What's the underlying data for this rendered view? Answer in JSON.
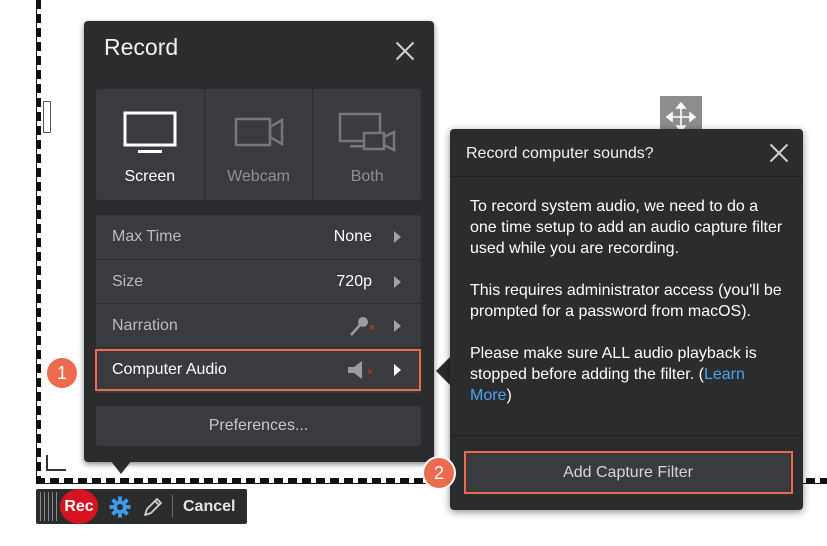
{
  "record_panel": {
    "title": "Record",
    "modes": [
      {
        "label": "Screen",
        "icon": "monitor-icon",
        "selected": true
      },
      {
        "label": "Webcam",
        "icon": "webcam-icon",
        "selected": false
      },
      {
        "label": "Both",
        "icon": "screen-webcam-icon",
        "selected": false
      }
    ],
    "rows": [
      {
        "label": "Max Time",
        "value": "None"
      },
      {
        "label": "Size",
        "value": "720p"
      },
      {
        "label": "Narration",
        "value_icon": "microphone-muted-icon"
      },
      {
        "label": "Computer Audio",
        "value_icon": "speaker-muted-icon"
      }
    ],
    "preferences_label": "Preferences..."
  },
  "popup": {
    "title": "Record computer sounds?",
    "paragraph1": "To record system audio, we need to do a one time setup to add an audio capture filter used while you are recording.",
    "paragraph2": "This requires administrator access (you'll be prompted for a password from macOS).",
    "paragraph3_text": "Please make sure ALL audio playback is stopped before adding the filter. (",
    "learn_more": "Learn More",
    "paragraph3_end": ")",
    "button_label": "Add Capture Filter"
  },
  "callouts": {
    "one": "1",
    "two": "2"
  },
  "toolbar": {
    "rec_label": "Rec",
    "cancel_label": "Cancel"
  },
  "colors": {
    "panel_bg": "#2b2c2e",
    "highlight": "#ec6a4e",
    "link": "#4aa3f0",
    "rec": "#d7131f",
    "gear": "#3e9bea"
  }
}
